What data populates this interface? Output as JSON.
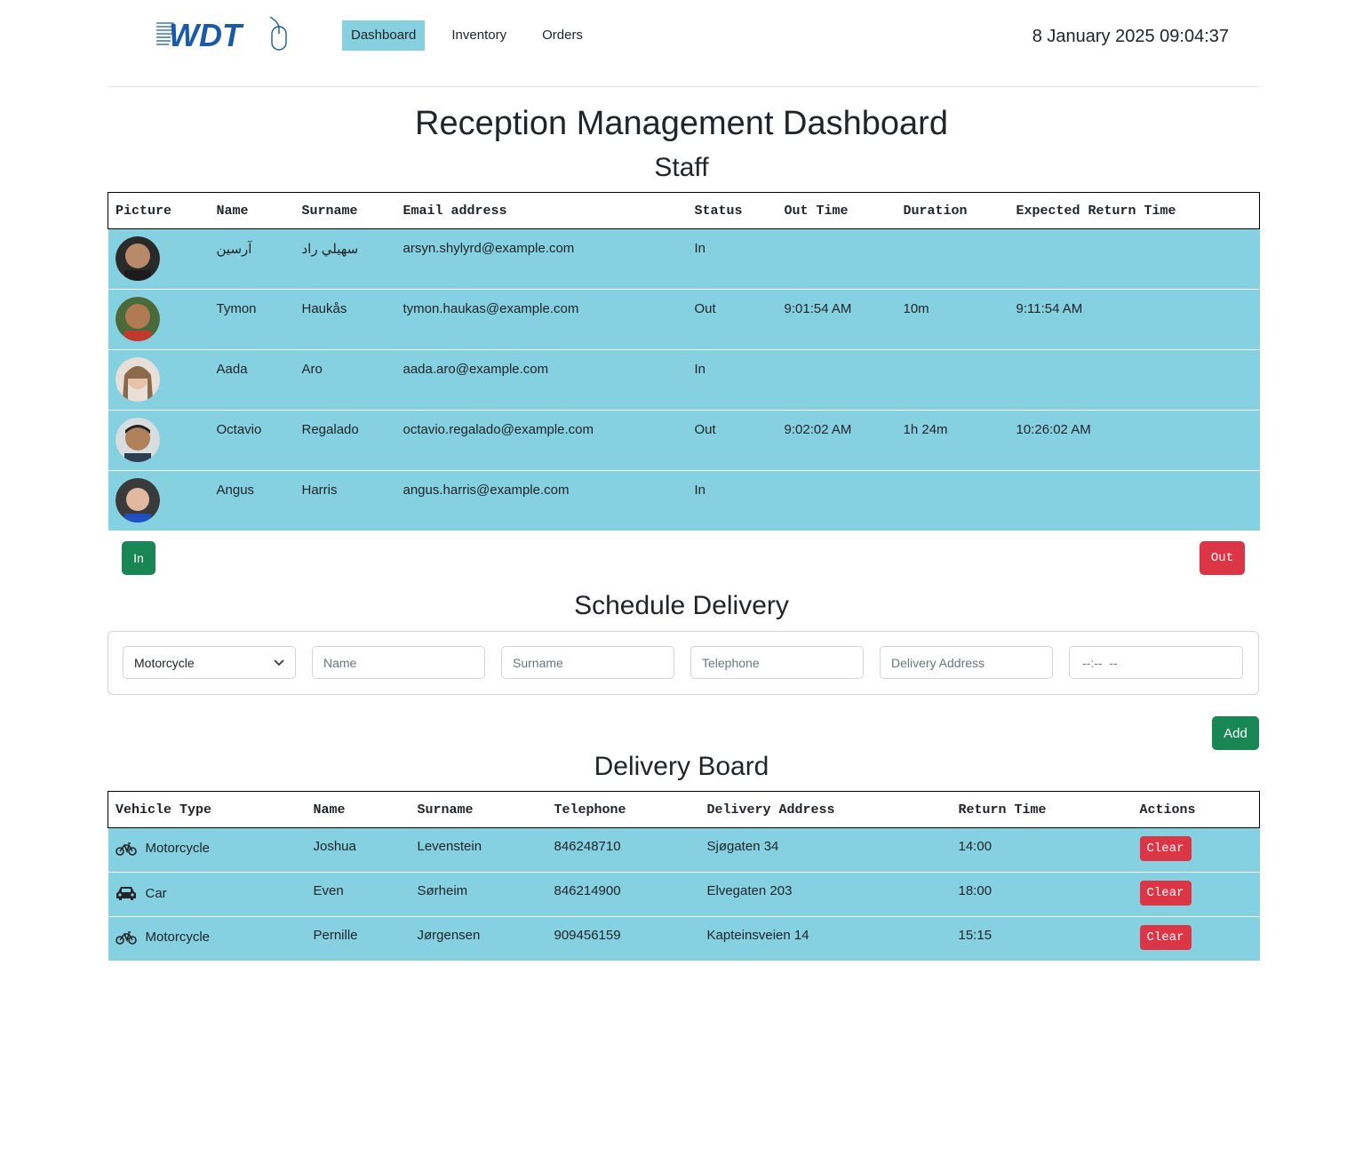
{
  "header": {
    "logo_text": "WDT",
    "nav": [
      "Dashboard",
      "Inventory",
      "Orders"
    ],
    "clock": "8 January 2025 09:04:37"
  },
  "page_title": "Reception Management Dashboard",
  "staff": {
    "title": "Staff",
    "columns": [
      "Picture",
      "Name",
      "Surname",
      "Email address",
      "Status",
      "Out Time",
      "Duration",
      "Expected Return Time"
    ],
    "rows": [
      {
        "name": "آرسین",
        "surname": "سهيلي راد",
        "email": "arsyn.shylyrd@example.com",
        "status": "In",
        "out_time": "",
        "duration": "",
        "expected": ""
      },
      {
        "name": "Tymon",
        "surname": "Haukås",
        "email": "tymon.haukas@example.com",
        "status": "Out",
        "out_time": "9:01:54 AM",
        "duration": "10m",
        "expected": "9:11:54 AM"
      },
      {
        "name": "Aada",
        "surname": "Aro",
        "email": "aada.aro@example.com",
        "status": "In",
        "out_time": "",
        "duration": "",
        "expected": ""
      },
      {
        "name": "Octavio",
        "surname": "Regalado",
        "email": "octavio.regalado@example.com",
        "status": "Out",
        "out_time": "9:02:02 AM",
        "duration": "1h 24m",
        "expected": "10:26:02 AM"
      },
      {
        "name": "Angus",
        "surname": "Harris",
        "email": "angus.harris@example.com",
        "status": "In",
        "out_time": "",
        "duration": "",
        "expected": ""
      }
    ],
    "in_label": "In",
    "out_label": "Out"
  },
  "schedule": {
    "title": "Schedule Delivery",
    "vehicle_value": "Motorcycle",
    "name_placeholder": "Name",
    "surname_placeholder": "Surname",
    "telephone_placeholder": "Telephone",
    "address_placeholder": "Delivery Address",
    "time_placeholder": "--:--  --",
    "add_label": "Add"
  },
  "delivery": {
    "title": "Delivery Board",
    "columns": [
      "Vehicle Type",
      "Name",
      "Surname",
      "Telephone",
      "Delivery Address",
      "Return Time",
      "Actions"
    ],
    "rows": [
      {
        "vehicle": "Motorcycle",
        "icon": "motorcycle-icon",
        "name": "Joshua",
        "surname": "Levenstein",
        "telephone": "846248710",
        "address": "Sjøgaten 34",
        "return_time": "14:00",
        "action": "Clear"
      },
      {
        "vehicle": "Car",
        "icon": "car-icon",
        "name": "Even",
        "surname": "Sørheim",
        "telephone": "846214900",
        "address": "Elvegaten 203",
        "return_time": "18:00",
        "action": "Clear"
      },
      {
        "vehicle": "Motorcycle",
        "icon": "motorcycle-icon",
        "name": "Pernille",
        "surname": "Jørgensen",
        "telephone": "909456159",
        "address": "Kapteinsveien 14",
        "return_time": "15:15",
        "action": "Clear"
      }
    ]
  },
  "colors": {
    "row_bg": "#85d1e1",
    "nav_active": "#87d0e0",
    "green": "#198754",
    "red": "#dc3545",
    "logo_blue": "#1a5aa8"
  }
}
